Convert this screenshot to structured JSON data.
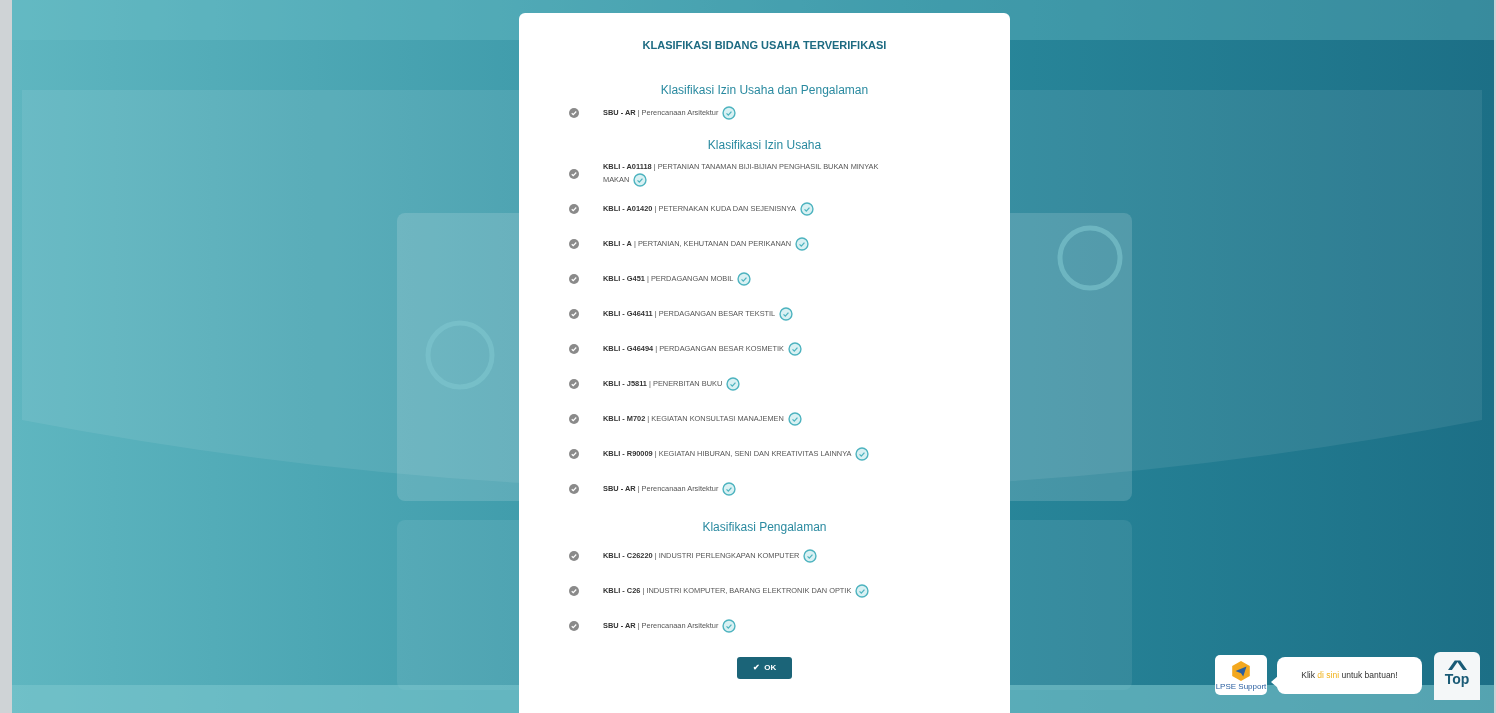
{
  "modal": {
    "title": "KLASIFIKASI BIDANG USAHA TERVERIFIKASI",
    "sections": [
      {
        "heading": "Klasifikasi Izin Usaha dan Pengalaman",
        "items": [
          {
            "text": "**SBU - AR** | Perencanaan Arsitektur",
            "verified": true
          }
        ]
      },
      {
        "heading": "Klasifikasi Izin Usaha",
        "items": [
          {
            "text": "**KBLI - A01118** | PERTANIAN TANAMAN BIJI-BIJIAN PENGHASIL BUKAN MINYAK MAKAN",
            "verified": true
          },
          {
            "text": "**KBLI - A01420** | PETERNAKAN KUDA DAN SEJENISNYA",
            "verified": true
          },
          {
            "text": "**KBLI - A** | PERTANIAN, KEHUTANAN DAN PERIKANAN",
            "verified": true
          },
          {
            "text": "**KBLI - G451** | PERDAGANGAN MOBIL",
            "verified": true
          },
          {
            "text": "**KBLI - G46411** | PERDAGANGAN BESAR TEKSTIL",
            "verified": true
          },
          {
            "text": "**KBLI - G46494** | PERDAGANGAN BESAR KOSMETIK",
            "verified": true
          },
          {
            "text": "**KBLI - J5811** | PENERBITAN BUKU",
            "verified": true
          },
          {
            "text": "**KBLI - M702** | KEGIATAN KONSULTASI MANAJEMEN",
            "verified": true
          },
          {
            "text": "**KBLI - R90009** | KEGIATAN HIBURAN, SENI DAN KREATIVITAS LAINNYA",
            "verified": true
          },
          {
            "text": "**SBU - AR** | Perencanaan Arsitektur",
            "verified": true
          }
        ]
      },
      {
        "heading": "Klasifikasi Pengalaman",
        "items": [
          {
            "text": "**KBLI - C26220** | INDUSTRI PERLENGKAPAN KOMPUTER",
            "verified": true
          },
          {
            "text": "**KBLI - C26** | INDUSTRI KOMPUTER, BARANG ELEKTRONIK DAN OPTIK",
            "verified": true
          },
          {
            "text": "**SBU - AR** | Perencanaan Arsitektur",
            "verified": true
          }
        ]
      }
    ],
    "ok_button": {
      "icon": "✔",
      "label": "OK"
    }
  },
  "help": {
    "logo_caption": "LPSE Support",
    "bubble_parts": [
      {
        "text": "Klik ",
        "highlight": false
      },
      {
        "text": "di sini",
        "highlight": true
      },
      {
        "text": " untuk bantuan!",
        "highlight": false
      }
    ]
  },
  "top_button": {
    "icon": "^",
    "label": "Top"
  }
}
